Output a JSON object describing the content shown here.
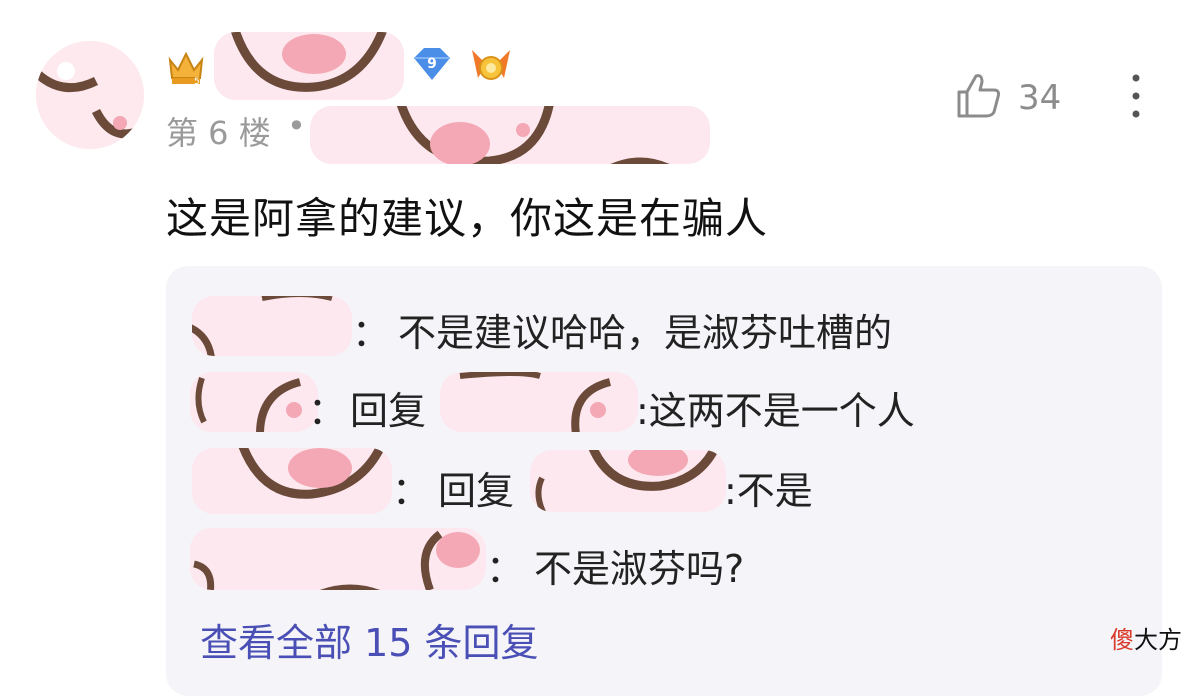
{
  "post": {
    "level_badge": "9",
    "floor_label": "第 6 楼",
    "floor_sep": "•",
    "like_count": "34",
    "comment_text": "这是阿拿的建议，你这是在骗人"
  },
  "replies": [
    {
      "sep": "：",
      "text": "不是建议哈哈，是淑芬吐槽的"
    },
    {
      "sep": "：",
      "reply_word": "回复",
      "text": ":这两不是一个人"
    },
    {
      "sep": "：",
      "reply_word": "回复",
      "text": ":不是"
    },
    {
      "sep": "：",
      "text": "不是淑芬吗?"
    }
  ],
  "view_all_label": "查看全部 15 条回复",
  "watermark": {
    "red": "傻",
    "black": "大方"
  },
  "colors": {
    "accent_link": "#4a4fb5",
    "mask_pink": "#fde8ef",
    "mask_brown": "#6b4a3a",
    "reply_bg": "#f5f4f8",
    "meta_gray": "#9a9a9a"
  },
  "icons": {
    "crown": "crown-icon",
    "level": "level-badge-icon",
    "medal": "medal-icon",
    "like": "thumbs-up-icon",
    "more": "more-vertical-icon"
  }
}
